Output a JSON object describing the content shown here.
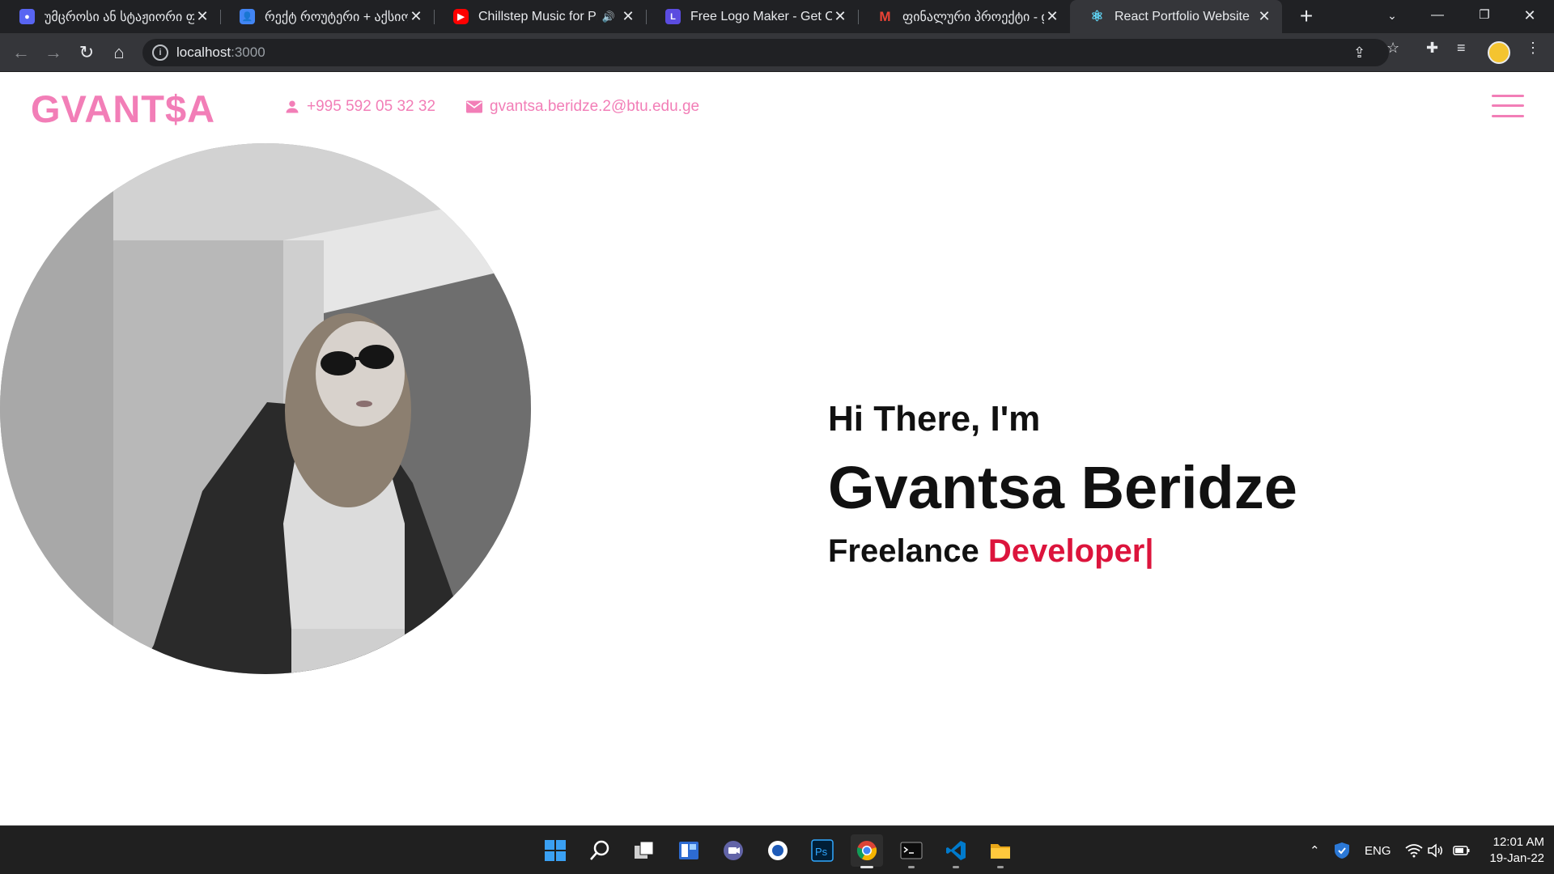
{
  "browser": {
    "tabs": [
      {
        "title": "უმცროსი ან სტაჟიორი ფ",
        "icon": "app-icon",
        "color": "#5865f2"
      },
      {
        "title": "რექტ როუტერი + აქსიო",
        "icon": "classroom-icon",
        "color": "#4285f4"
      },
      {
        "title": "Chillstep Music for Prog",
        "icon": "youtube-icon",
        "color": "#ff0000"
      },
      {
        "title": "Free Logo Maker - Get Cust",
        "icon": "logo-maker-icon",
        "color": "#5b4ce0"
      },
      {
        "title": "ფინალური პროექტი - g",
        "icon": "gmail-icon",
        "color": "#ea4335"
      },
      {
        "title": "React Portfolio Website",
        "icon": "react-icon",
        "color": "#61dafb"
      }
    ],
    "url_host": "localhost",
    "url_port": ":3000"
  },
  "site": {
    "logo": "GVANT$A",
    "phone": "+995 592 05 32 32",
    "email": "gvantsa.beridze.2@btu.edu.ge",
    "greeting": "Hi There, I'm",
    "name": "Gvantsa Beridze",
    "role_prefix": "Freelance",
    "role_highlight": "Developer|",
    "accent_color": "#f27eb7",
    "highlight_color": "#dc143c"
  },
  "taskbar": {
    "apps": [
      "windows-start-icon",
      "search-icon",
      "task-view-icon",
      "widgets-icon",
      "teams-chat-icon",
      "app-icon",
      "photoshop-icon",
      "chrome-icon",
      "terminal-icon",
      "vscode-icon",
      "file-explorer-icon"
    ],
    "language": "ENG",
    "time": "12:01 AM",
    "date": "19-Jan-22"
  }
}
